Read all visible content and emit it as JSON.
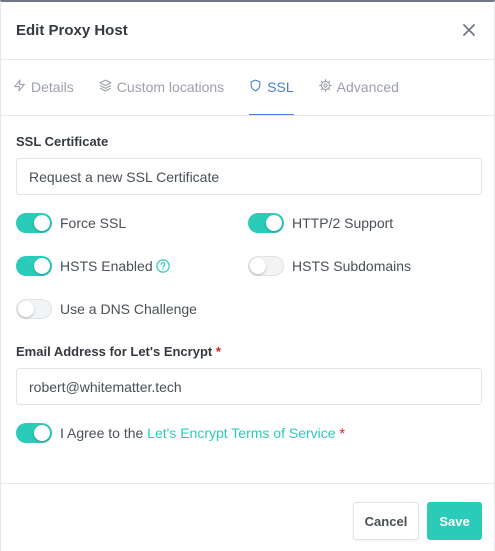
{
  "header": {
    "title": "Edit Proxy Host",
    "close_icon": "close-icon"
  },
  "tabs": [
    {
      "label": "Details",
      "icon": "lightning-icon",
      "active": false
    },
    {
      "label": "Custom locations",
      "icon": "layers-icon",
      "active": false
    },
    {
      "label": "SSL",
      "icon": "shield-icon",
      "active": true
    },
    {
      "label": "Advanced",
      "icon": "gear-icon",
      "active": false
    }
  ],
  "ssl": {
    "certificate_label": "SSL Certificate",
    "certificate_value": "Request a new SSL Certificate",
    "switches": {
      "force_ssl": {
        "label": "Force SSL",
        "on": true
      },
      "http2": {
        "label": "HTTP/2 Support",
        "on": true
      },
      "hsts_enabled": {
        "label": "HSTS Enabled",
        "on": true
      },
      "hsts_subdomains": {
        "label": "HSTS Subdomains",
        "on": false
      },
      "dns_challenge": {
        "label": "Use a DNS Challenge",
        "on": false
      }
    },
    "email_label": "Email Address for Let's Encrypt",
    "required_mark": "*",
    "email_value": "robert@whitematter.tech",
    "agree_prefix": "I Agree to the ",
    "agree_link": "Let's Encrypt Terms of Service",
    "agree_on": true
  },
  "footer": {
    "cancel_label": "Cancel",
    "save_label": "Save"
  },
  "colors": {
    "accent": "#2bcbba",
    "tab_active": "#467fcf",
    "required": "#cd201f"
  }
}
